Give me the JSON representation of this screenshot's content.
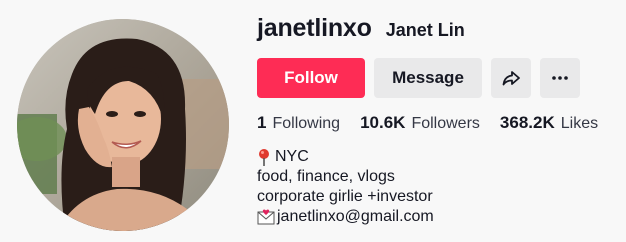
{
  "profile": {
    "username": "janetlinxo",
    "nickname": "Janet Lin"
  },
  "actions": {
    "follow_label": "Follow",
    "message_label": "Message",
    "share_icon": "share-arrow-icon",
    "more_icon": "more-ellipsis-icon"
  },
  "stats": [
    {
      "value": "1",
      "label": "Following"
    },
    {
      "value": "10.6K",
      "label": "Followers"
    },
    {
      "value": "368.2K",
      "label": "Likes"
    }
  ],
  "bio": {
    "location": "NYC",
    "line2": "food, finance, vlogs",
    "line3": "corporate girlie +investor",
    "email": "janetlinxo@gmail.com"
  },
  "colors": {
    "follow": "#fe2c55",
    "secondary_button": "#e9e9ea",
    "text": "#161823",
    "background": "#f8f8f8"
  }
}
